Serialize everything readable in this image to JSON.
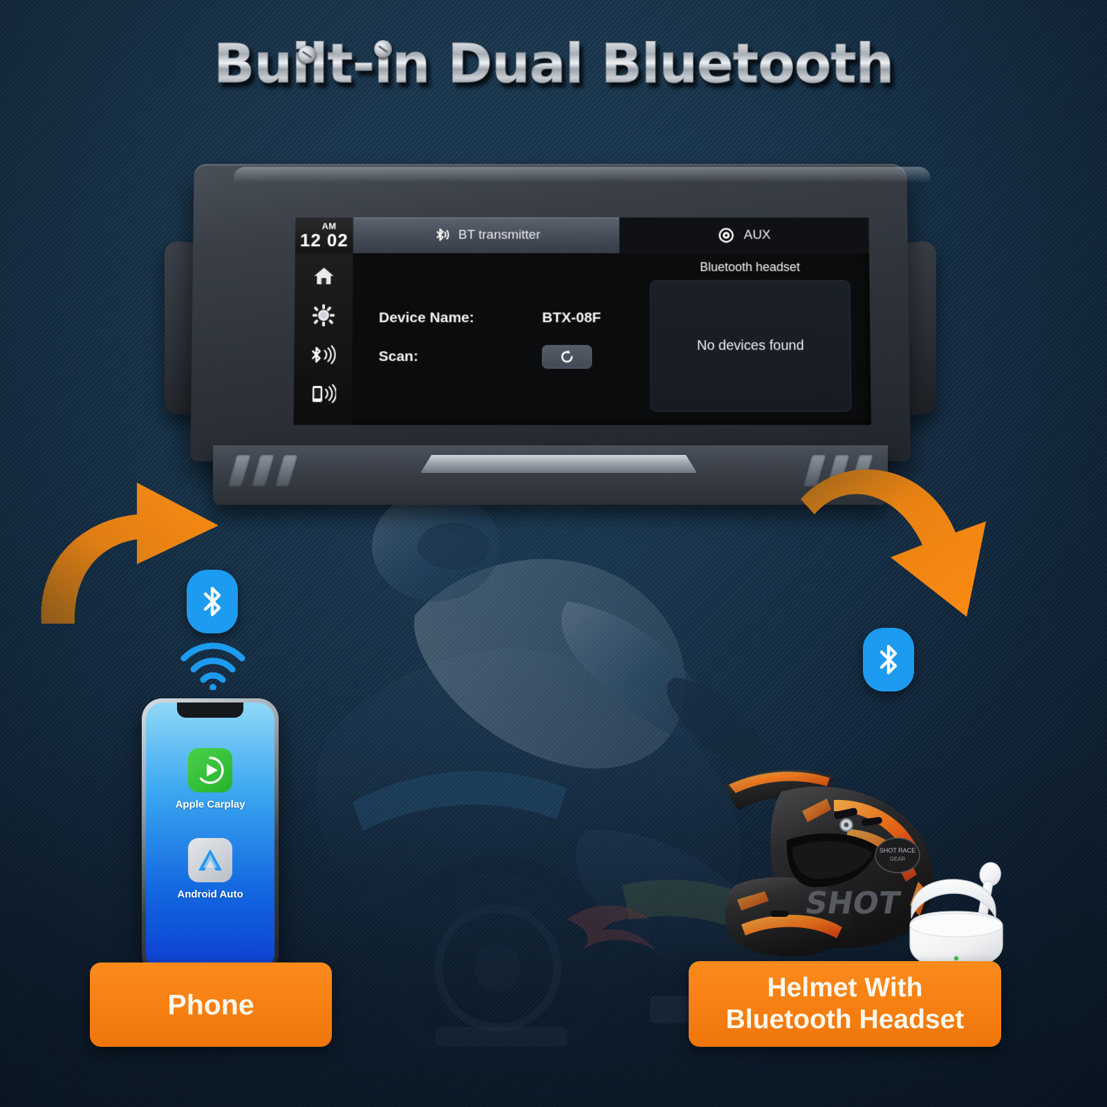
{
  "page": {
    "headline": "Built-in Dual Bluetooth",
    "background_color": "#16324a",
    "accent_color": "#f77f12",
    "bluetooth_color": "#1d9bf0"
  },
  "device_screen": {
    "clock": {
      "ampm": "AM",
      "time": "12 02"
    },
    "sidebar_icons": [
      {
        "name": "home-icon",
        "label": "Home"
      },
      {
        "name": "settings-icon",
        "label": "Settings"
      },
      {
        "name": "bluetooth-audio-icon",
        "label": "Bluetooth Audio"
      },
      {
        "name": "phone-link-icon",
        "label": "Phone Link"
      }
    ],
    "tabs": [
      {
        "label": "BT transmitter",
        "icon": "bluetooth-transmit-icon",
        "active": true
      },
      {
        "label": "AUX",
        "icon": "aux-jack-icon",
        "active": false
      }
    ],
    "settings": {
      "device_name_label": "Device Name:",
      "device_name_value": "BTX-08F",
      "scan_label": "Scan:",
      "scan_button_icon": "refresh-icon"
    },
    "headset_panel": {
      "title": "Bluetooth headset",
      "empty_state": "No devices found"
    }
  },
  "phone": {
    "apps": [
      {
        "name": "apple-carplay",
        "label": "Apple Carplay"
      },
      {
        "name": "android-auto",
        "label": "Android Auto"
      }
    ]
  },
  "callouts": [
    {
      "name": "phone-callout",
      "text": "Phone"
    },
    {
      "name": "helmet-callout",
      "line1": "Helmet With",
      "line2": "Bluetooth Headset"
    }
  ],
  "arrows": [
    {
      "name": "arrow-left-to-device",
      "direction": "up-right",
      "color": "#f58220"
    },
    {
      "name": "arrow-right-to-helmet",
      "direction": "down-right",
      "color": "#f58220"
    }
  ],
  "wireless_badges": [
    {
      "name": "bluetooth-badge-left",
      "icon": "bluetooth-icon"
    },
    {
      "name": "wifi-badge",
      "icon": "wifi-icon"
    },
    {
      "name": "bluetooth-badge-right",
      "icon": "bluetooth-icon"
    }
  ]
}
